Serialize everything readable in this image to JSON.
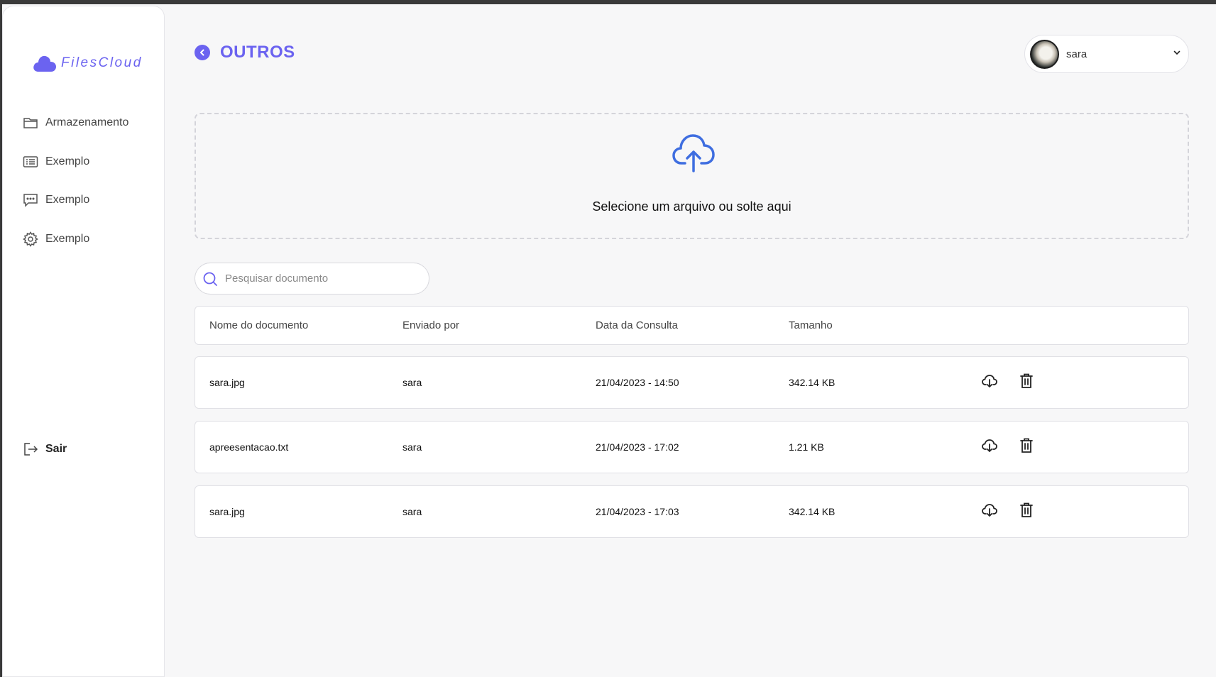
{
  "app": {
    "name": "FilesCloud"
  },
  "sidebar": {
    "items": [
      {
        "label": "Armazenamento",
        "icon": "folder-icon"
      },
      {
        "label": "Exemplo",
        "icon": "list-card-icon"
      },
      {
        "label": "Exemplo",
        "icon": "chat-icon"
      },
      {
        "label": "Exemplo",
        "icon": "gear-icon"
      }
    ],
    "logout_label": "Sair"
  },
  "header": {
    "title": "OUTROS",
    "user": {
      "name": "sara"
    }
  },
  "upload": {
    "text": "Selecione um arquivo ou solte aqui"
  },
  "search": {
    "placeholder": "Pesquisar documento",
    "value": ""
  },
  "table": {
    "columns": [
      "Nome do documento",
      "Enviado por",
      "Data da Consulta",
      "Tamanho"
    ],
    "rows": [
      {
        "name": "sara.jpg",
        "sender": "sara",
        "date": "21/04/2023 - 14:50",
        "size": "342.14 KB"
      },
      {
        "name": "apreesentacao.txt",
        "sender": "sara",
        "date": "21/04/2023 - 17:02",
        "size": "1.21 KB"
      },
      {
        "name": "sara.jpg",
        "sender": "sara",
        "date": "21/04/2023 - 17:03",
        "size": "342.14 KB"
      }
    ]
  },
  "colors": {
    "accent": "#6b63f0",
    "upload_icon": "#3f6ee0"
  }
}
